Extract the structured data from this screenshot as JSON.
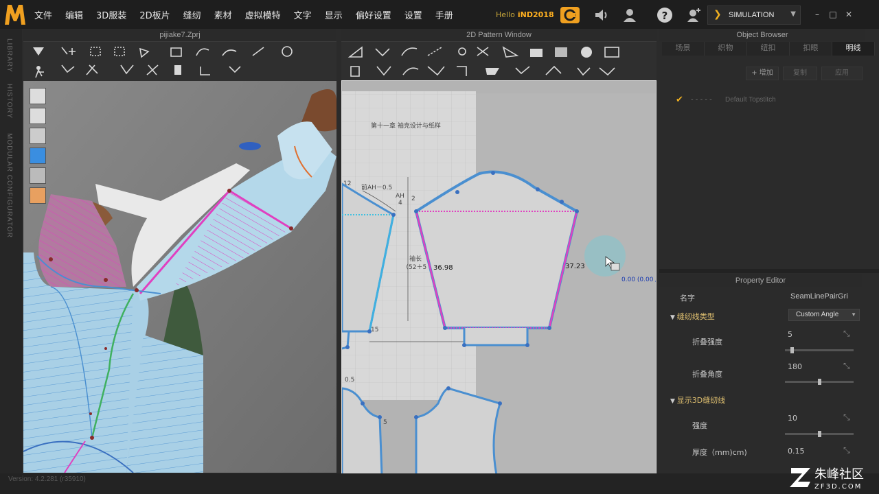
{
  "app": {
    "menu": [
      "文件",
      "编辑",
      "3D服装",
      "2D板片",
      "缝纫",
      "素材",
      "虚拟模特",
      "文字",
      "显示",
      "偏好设置",
      "设置",
      "手册"
    ],
    "hello_label": "Hello",
    "user": "iND2018",
    "mode": "SIMULATION"
  },
  "left_strip": {
    "tabs": [
      "LIBRARY",
      "HISTORY",
      "MODULAR CONFIGURATOR"
    ]
  },
  "view3d": {
    "title": "pijiake7.Zprj"
  },
  "view2d": {
    "title": "2D Pattern Window",
    "measure_left": "36.98",
    "measure_right": "37.23",
    "coord": "0.00 (0.00 /",
    "ref_title": "第十一章  袖克设计与纸样",
    "ref_ah": "前AH－0.5",
    "ref_ah2": "AH",
    "ref_ah3": "4",
    "ref_2": "2",
    "ref_12": "12",
    "ref_sleeve": "袖长",
    "ref_formula": "（52＋5",
    "ref_15": "15",
    "ref_05": "0.5",
    "ref_5": "5"
  },
  "object_browser": {
    "title": "Object Browser",
    "tabs": [
      "场景",
      "织物",
      "纽扣",
      "扣眼",
      "明线"
    ],
    "active_tab": 4,
    "add_label": "+ 增加",
    "copy_label": "复制",
    "apply_label": "应用",
    "item": "Default Topstitch",
    "item_dash": "- - - - -"
  },
  "property_editor": {
    "title": "Property Editor",
    "name_label": "名字",
    "name_value": "SeamLinePairGri",
    "sec1": "缝纫线类型",
    "sec1_value": "Custom Angle",
    "fold_strength_label": "折叠强度",
    "fold_strength": "5",
    "fold_strength_frac": 0.1,
    "fold_angle_label": "折叠角度",
    "fold_angle": "180",
    "fold_angle_frac": 0.5,
    "sec2": "显示3D缝纫线",
    "strength_label": "强度",
    "strength": "10",
    "strength_frac": 0.5,
    "thickness_label": "厚度（mm)cm)",
    "thickness": "0.15"
  },
  "status": {
    "version": "Version: 4.2.281 (r35910)"
  },
  "watermark": {
    "text": "朱峰社区",
    "url": "ZF3D.COM"
  },
  "colors": {
    "accent": "#f0b020",
    "seam_pink": "#e040c0",
    "pattern_blue": "#4a8fd0",
    "cloth": "#a9d0e6"
  }
}
